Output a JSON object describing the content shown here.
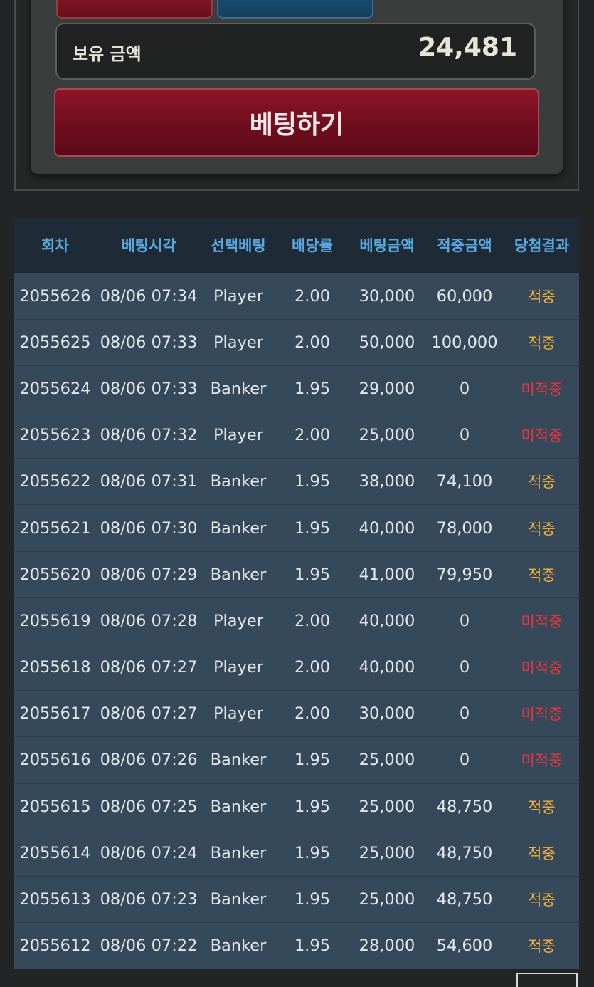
{
  "balance": {
    "label": "보유 금액",
    "value": "24,481"
  },
  "bet_button_label": "베팅하기",
  "colors": {
    "accent_red": "#7d1022",
    "header_blue": "#5aa9e0",
    "hit": "#f4b13c",
    "miss": "#e8363e",
    "row_bg": "#35495a"
  },
  "history": {
    "headers": [
      "회차",
      "베팅시각",
      "선택베팅",
      "배당률",
      "베팅금액",
      "적중금액",
      "당첨결과"
    ],
    "rows": [
      [
        "2055626",
        "08/06 07:34",
        "Player",
        "2.00",
        "30,000",
        "60,000",
        "적중"
      ],
      [
        "2055625",
        "08/06 07:33",
        "Player",
        "2.00",
        "50,000",
        "100,000",
        "적중"
      ],
      [
        "2055624",
        "08/06 07:33",
        "Banker",
        "1.95",
        "29,000",
        "0",
        "미적중"
      ],
      [
        "2055623",
        "08/06 07:32",
        "Player",
        "2.00",
        "25,000",
        "0",
        "미적중"
      ],
      [
        "2055622",
        "08/06 07:31",
        "Banker",
        "1.95",
        "38,000",
        "74,100",
        "적중"
      ],
      [
        "2055621",
        "08/06 07:30",
        "Banker",
        "1.95",
        "40,000",
        "78,000",
        "적중"
      ],
      [
        "2055620",
        "08/06 07:29",
        "Banker",
        "1.95",
        "41,000",
        "79,950",
        "적중"
      ],
      [
        "2055619",
        "08/06 07:28",
        "Player",
        "2.00",
        "40,000",
        "0",
        "미적중"
      ],
      [
        "2055618",
        "08/06 07:27",
        "Player",
        "2.00",
        "40,000",
        "0",
        "미적중"
      ],
      [
        "2055617",
        "08/06 07:27",
        "Player",
        "2.00",
        "30,000",
        "0",
        "미적중"
      ],
      [
        "2055616",
        "08/06 07:26",
        "Banker",
        "1.95",
        "25,000",
        "0",
        "미적중"
      ],
      [
        "2055615",
        "08/06 07:25",
        "Banker",
        "1.95",
        "25,000",
        "48,750",
        "적중"
      ],
      [
        "2055614",
        "08/06 07:24",
        "Banker",
        "1.95",
        "25,000",
        "48,750",
        "적중"
      ],
      [
        "2055613",
        "08/06 07:23",
        "Banker",
        "1.95",
        "25,000",
        "48,750",
        "적중"
      ],
      [
        "2055612",
        "08/06 07:22",
        "Banker",
        "1.95",
        "28,000",
        "54,600",
        "적중"
      ]
    ]
  }
}
